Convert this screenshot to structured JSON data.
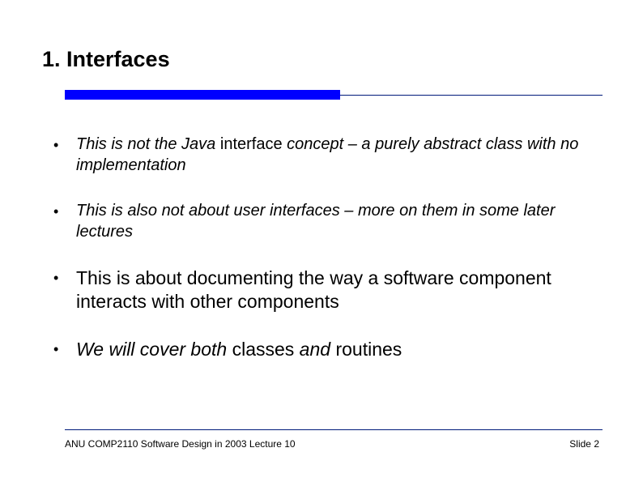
{
  "title": "1. Interfaces",
  "bullets": [
    {
      "size": "sm",
      "parts": [
        {
          "text": "This is not the Java ",
          "style": "it"
        },
        {
          "text": "interface",
          "style": "nit"
        },
        {
          "text": " concept – a purely abstract class with no implementation",
          "style": "it"
        }
      ]
    },
    {
      "size": "sm",
      "parts": [
        {
          "text": "This is also not about user interfaces – more on them in some later lectures",
          "style": "it"
        }
      ]
    },
    {
      "size": "lg",
      "parts": [
        {
          "text": "This is about documenting the way a software component interacts with other components",
          "style": "nit"
        }
      ]
    },
    {
      "size": "lg",
      "parts": [
        {
          "text": "We will cover both ",
          "style": "it"
        },
        {
          "text": "classes",
          "style": "nit"
        },
        {
          "text": " and ",
          "style": "it"
        },
        {
          "text": "routines",
          "style": "nit"
        }
      ]
    }
  ],
  "footer": {
    "left": "ANU COMP2110 Software Design in 2003 Lecture 10",
    "right": "Slide 2"
  },
  "bullet_glyph": "•"
}
